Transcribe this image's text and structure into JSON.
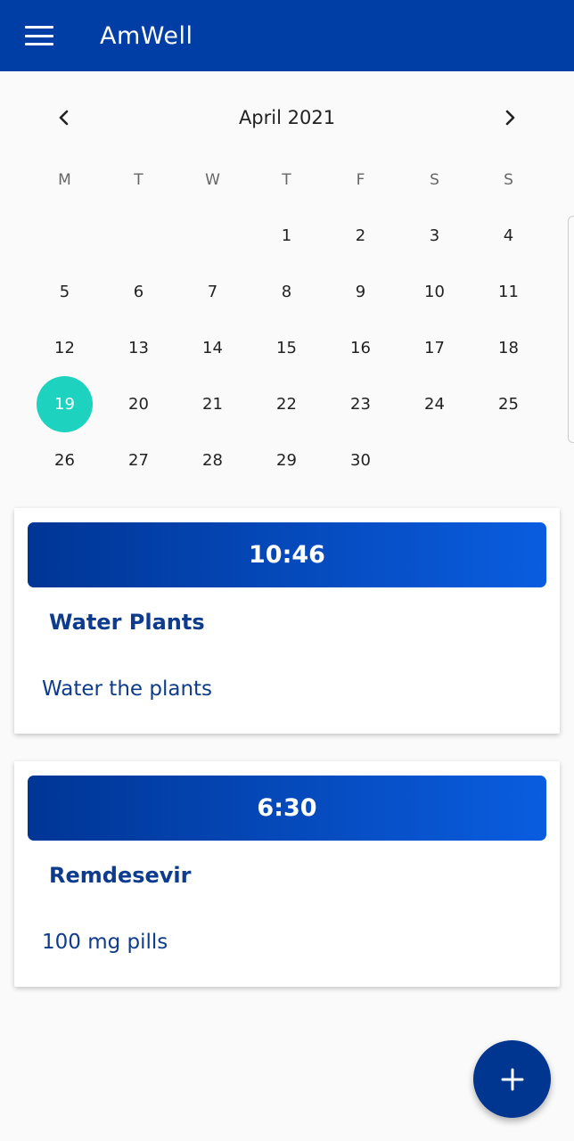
{
  "appbar": {
    "title": "AmWell"
  },
  "calendar": {
    "month_label": "April 2021",
    "weekdays": [
      "M",
      "T",
      "W",
      "T",
      "F",
      "S",
      "S"
    ],
    "leading_blanks": 3,
    "days": [
      "1",
      "2",
      "3",
      "4",
      "5",
      "6",
      "7",
      "8",
      "9",
      "10",
      "11",
      "12",
      "13",
      "14",
      "15",
      "16",
      "17",
      "18",
      "19",
      "20",
      "21",
      "22",
      "23",
      "24",
      "25",
      "26",
      "27",
      "28",
      "29",
      "30"
    ],
    "selected_day": "19",
    "selected_color": "#1dd3c0"
  },
  "reminders": [
    {
      "time": "10:46",
      "title": "Water Plants",
      "description": "Water the plants"
    },
    {
      "time": "6:30",
      "title": "Remdesevir",
      "description": "100 mg pills"
    }
  ],
  "colors": {
    "primary": "#003da5",
    "accent": "#1dd3c0"
  },
  "icons": {
    "menu": "menu-icon",
    "prev": "chevron-left-icon",
    "next": "chevron-right-icon",
    "add": "plus-icon"
  }
}
